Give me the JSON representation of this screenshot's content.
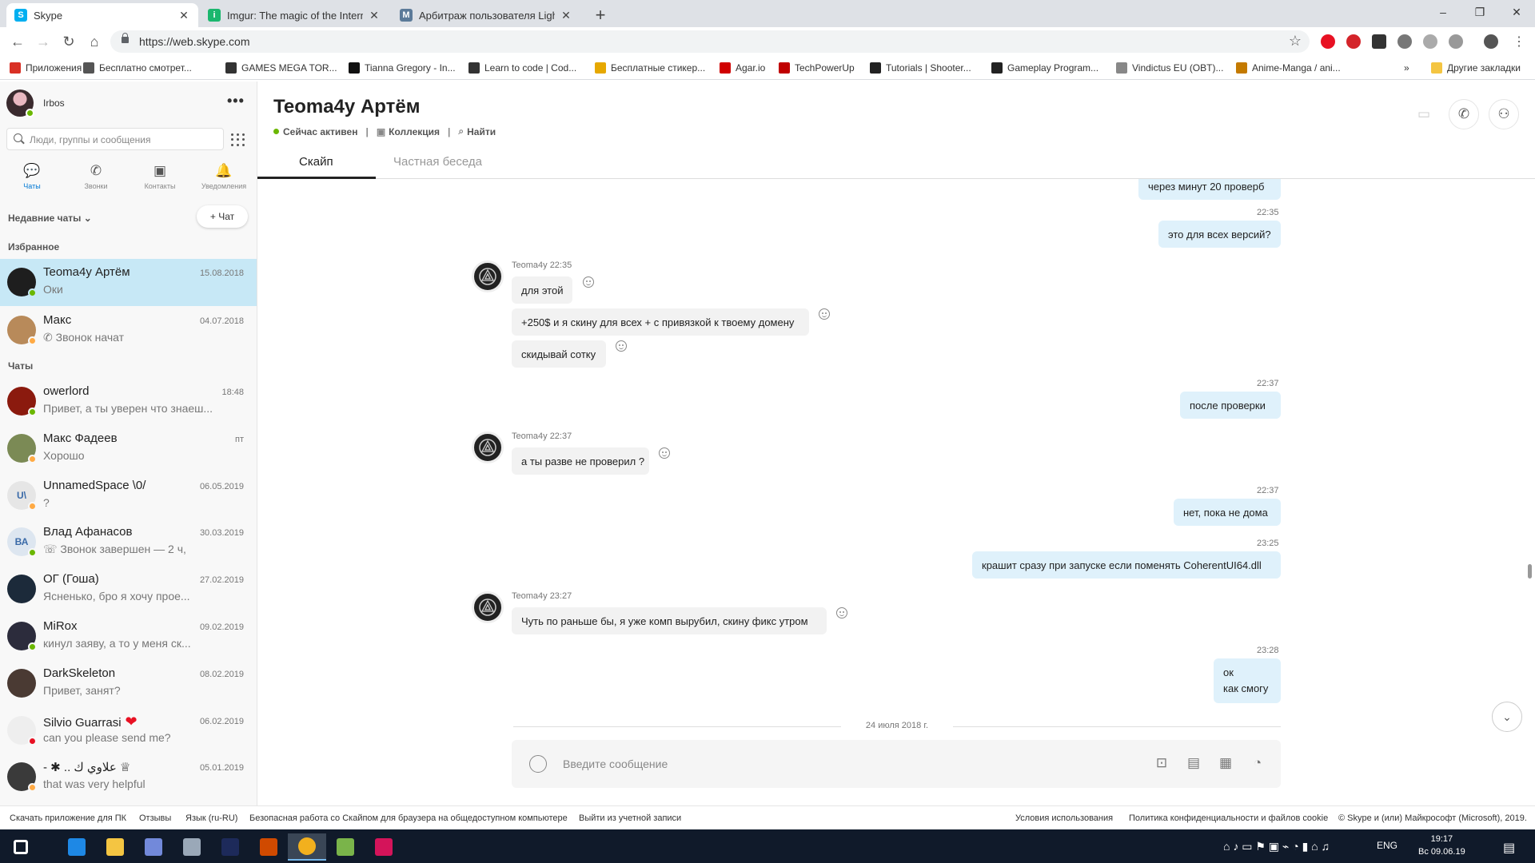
{
  "browser": {
    "tabs": [
      {
        "title": "Skype",
        "favicon": "skype-icon",
        "active": true
      },
      {
        "title": "Imgur: The magic of the Internet",
        "favicon": "imgur-icon",
        "active": false
      },
      {
        "title": "Арбитраж пользователя LightF",
        "favicon": "habr-icon",
        "active": false
      }
    ],
    "close_glyph": "✕",
    "new_tab_glyph": "+",
    "url": "https://web.skype.com",
    "window_controls": {
      "minimize": "–",
      "maximize": "❐",
      "close": "✕"
    }
  },
  "bookmarks": [
    {
      "label": "Приложения",
      "icon": "apps-grid-icon",
      "color": "#d93025"
    },
    {
      "label": "Бесплатно смотрет...",
      "icon": "film-icon",
      "color": "#555555"
    },
    {
      "label": "GAMES MEGA TOR...",
      "icon": "car-icon",
      "color": "#333333"
    },
    {
      "label": "Tianna Gregory - In...",
      "icon": "ink-icon",
      "color": "#111111"
    },
    {
      "label": "Learn to code | Cod...",
      "icon": "code-icon",
      "color": "#333333"
    },
    {
      "label": "Бесплатные стикер...",
      "icon": "sticker-icon",
      "color": "#e6a800"
    },
    {
      "label": "Agar.io",
      "icon": "agar-icon",
      "color": "#d00000"
    },
    {
      "label": "TechPowerUp",
      "icon": "power-icon",
      "color": "#c00000"
    },
    {
      "label": "Tutorials | Shooter...",
      "icon": "tutorial-icon",
      "color": "#222222"
    },
    {
      "label": "Gameplay Program...",
      "icon": "unreal-icon",
      "color": "#222222"
    },
    {
      "label": "Vindictus EU (OBT)...",
      "icon": "vindictus-icon",
      "color": "#888888"
    },
    {
      "label": "Anime-Manga / ani...",
      "icon": "anime-icon",
      "color": "#c47a00"
    }
  ],
  "bookmarks_more": "»",
  "other_bookmarks": "Другие закладки",
  "me": {
    "name": "Irbos"
  },
  "sidebar": {
    "more_glyph": "•••",
    "search_placeholder": "Люди, группы и сообщения",
    "nav": [
      {
        "label": "Чаты",
        "icon": "chat-icon",
        "glyph": "💬"
      },
      {
        "label": "Звонки",
        "icon": "phone-icon",
        "glyph": "✆"
      },
      {
        "label": "Контакты",
        "icon": "contacts-icon",
        "glyph": "▣"
      },
      {
        "label": "Уведомления",
        "icon": "bell-icon",
        "glyph": "🔔"
      }
    ],
    "recent_label": "Недавние чаты ⌄",
    "new_chat": "+ Чат",
    "favorites_label": "Избранное",
    "chats_label": "Чаты",
    "favorites": [
      {
        "name": "Teoma4y Артём",
        "preview": "Оки",
        "date": "15.08.2018",
        "avatar": "#1e1e1e",
        "status": "#6bb700"
      },
      {
        "name": "Макс",
        "preview": "✆ Звонок начат",
        "date": "04.07.2018",
        "avatar": "#b88a5a",
        "status": "#ffaa44"
      }
    ],
    "chats": [
      {
        "name": "owerlord",
        "preview": "Привет, а ты уверен что знаеш...",
        "date": "18:48",
        "avatar": "#8b1a0e",
        "status": "#6bb700",
        "initials": ""
      },
      {
        "name": "Макс Фадеев",
        "preview": "Хорошо",
        "date": "пт",
        "avatar": "#7b8a55",
        "status": "#ffaa44",
        "initials": ""
      },
      {
        "name": "UnnamedSpace \\0/",
        "preview": "?",
        "date": "06.05.2019",
        "avatar": "#e6e6e6",
        "status": "#ffaa44",
        "initials": "U\\"
      },
      {
        "name": "Влад Афанасов",
        "preview": "☏ Звонок завершен — 2 ч,",
        "date": "30.03.2019",
        "avatar": "#dde6f0",
        "status": "#6bb700",
        "initials": "ВА"
      },
      {
        "name": "ОГ (Гоша)",
        "preview": "Ясненько, бро я хочу прое...",
        "date": "27.02.2019",
        "avatar": "#1c2a3a",
        "status": "",
        "initials": ""
      },
      {
        "name": "MiRox",
        "preview": "кинул заяву, а то у меня ск...",
        "date": "09.02.2019",
        "avatar": "#2c2c3c",
        "status": "#6bb700",
        "initials": ""
      },
      {
        "name": "DarkSkeleton",
        "preview": "Привет, занят?",
        "date": "08.02.2019",
        "avatar": "#4a3a33",
        "status": "",
        "initials": ""
      },
      {
        "name": "Silvio Guarrasi",
        "preview": "can you please send me?",
        "date": "06.02.2019",
        "avatar": "#eeeeee",
        "status": "#e81123",
        "initials": "",
        "heart": "❤"
      },
      {
        "name": "- ✱ .. علاوي ﻙ ♕",
        "preview": "that was very helpful",
        "date": "05.01.2019",
        "avatar": "#3a3a3a",
        "status": "#ffaa44",
        "initials": ""
      }
    ]
  },
  "conversation": {
    "title": "Teoma4y Артём",
    "status": "Сейчас активен",
    "collection": "Коллекция",
    "find": "Найти",
    "tabs": [
      "Скайп",
      "Частная беседа"
    ],
    "header_buttons": [
      {
        "name": "video-call-icon",
        "glyph": "▭"
      },
      {
        "name": "phone-call-icon",
        "glyph": "✆"
      },
      {
        "name": "add-person-icon",
        "glyph": "⚇"
      }
    ],
    "messages": [
      {
        "dir": "out",
        "text": "через минут 20 проверб"
      },
      {
        "dir": "out",
        "time": "22:35",
        "text": "это для всех версий?"
      },
      {
        "dir": "in",
        "sender": "Teoma4y 22:35",
        "texts": [
          "для этой",
          "+250$ и я скину для всех + с привязкой к твоему домену",
          "скидывай сотку"
        ]
      },
      {
        "dir": "out",
        "time": "22:37",
        "text": "после проверки"
      },
      {
        "dir": "in",
        "sender": "Teoma4y 22:37",
        "texts": [
          "а ты разве не проверил ?"
        ]
      },
      {
        "dir": "out",
        "time": "22:37",
        "text": "нет, пока не дома"
      },
      {
        "dir": "out",
        "time": "23:25",
        "text": "крашит сразу при запуске если поменять CoherentUI64.dll"
      },
      {
        "dir": "in",
        "sender": "Teoma4y 23:27",
        "texts": [
          "Чуть по раньше бы, я уже комп вырубил, скину фикс утром"
        ]
      },
      {
        "dir": "out",
        "time": "23:28",
        "text": "ок",
        "text2": "как смогу"
      }
    ],
    "day_separator": "24 июля 2018 г.",
    "composer_placeholder": "Введите сообщение",
    "composer_buttons": [
      {
        "name": "attach-image-icon",
        "glyph": "⊡"
      },
      {
        "name": "contact-card-icon",
        "glyph": "▤"
      },
      {
        "name": "calendar-icon",
        "glyph": "▦"
      },
      {
        "name": "poll-icon",
        "glyph": "◔"
      }
    ],
    "scroll_down": "⌄"
  },
  "footer": {
    "left": [
      "Скачать приложение для ПК",
      "Отзывы",
      "Язык (ru-RU)",
      "Безопасная работа со Скайпом для браузера на общедоступном компьютере",
      "Выйти из учетной записи"
    ],
    "right": [
      "Условия использования",
      "Политика конфиденциальности и файлов cookie",
      "© Skype и (или) Майкрософт (Microsoft), 2019."
    ]
  },
  "taskbar": {
    "apps": [
      {
        "name": "start-icon",
        "color": "#ffffff"
      },
      {
        "name": "edge-icon",
        "color": "#1e88e5"
      },
      {
        "name": "file-explorer-icon",
        "color": "#f4c542"
      },
      {
        "name": "discord-icon",
        "color": "#7289da"
      },
      {
        "name": "steam-icon",
        "color": "#9aa8b8"
      },
      {
        "name": "photoshop-icon",
        "color": "#1d2a5a"
      },
      {
        "name": "ark-icon",
        "color": "#d04a00"
      },
      {
        "name": "chrome-icon",
        "color": "#f2b01e"
      },
      {
        "name": "notepad-icon",
        "color": "#7ab44a"
      },
      {
        "name": "jetbrains-icon",
        "color": "#d4145a"
      }
    ],
    "lang": "ENG",
    "time": "19:17",
    "date": "Вс 09.06.19"
  }
}
